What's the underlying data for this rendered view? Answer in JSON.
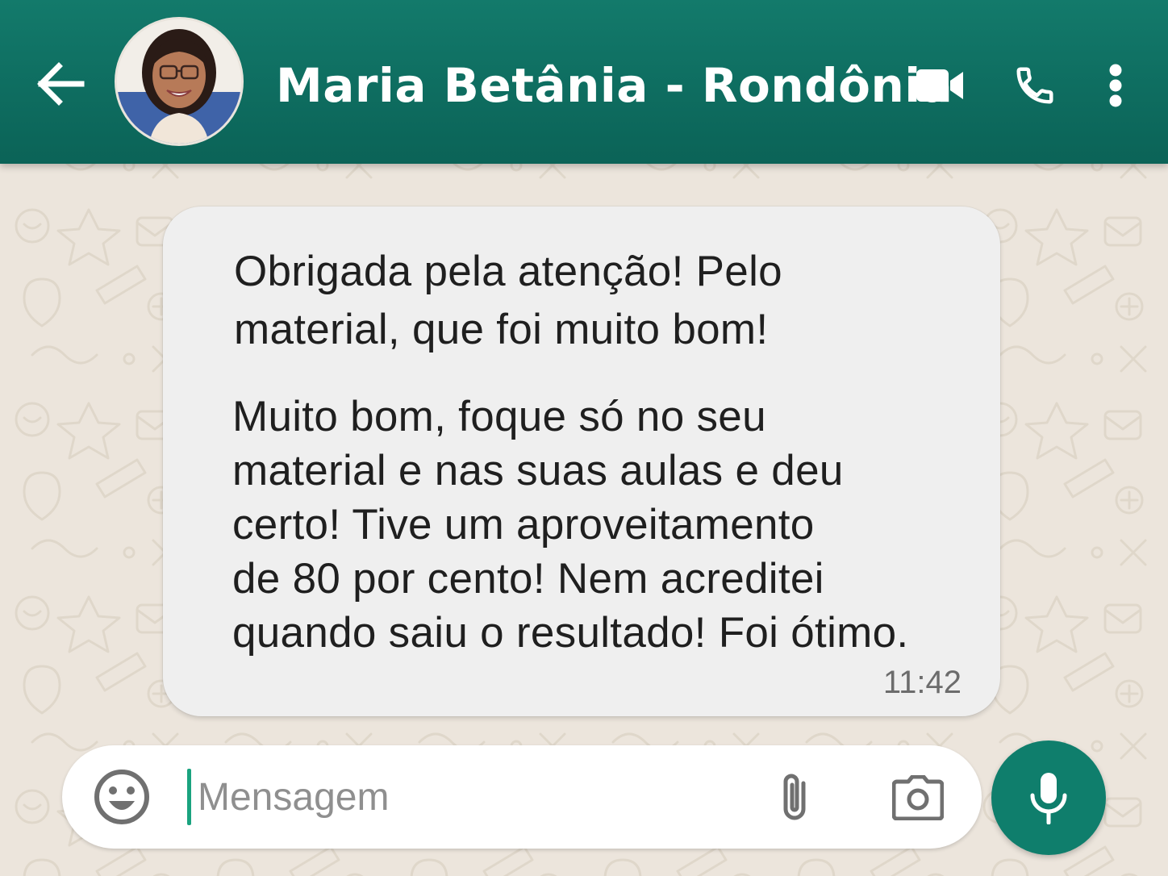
{
  "header": {
    "contact_name": "Maria Betânia - Rondônia",
    "back_icon": "arrow-left-icon",
    "video_icon": "video-camera-icon",
    "call_icon": "phone-icon",
    "menu_icon": "more-vertical-icon",
    "background_color": "#0e6d60"
  },
  "conversation": {
    "messages": [
      {
        "paragraph_1": "Obrigada pela atenção! Pelo\nmaterial, que foi muito bom!",
        "paragraph_2": "Muito bom, foque só no seu\n material e nas suas aulas e deu\n certo! Tive um aproveitamento\n de 80 por cento! Nem acreditei\n quando saiu o resultado! Foi ótimo.",
        "time": "11:42"
      }
    ]
  },
  "composer": {
    "placeholder": "Mensagem",
    "emoji_icon": "emoji-icon",
    "attach_icon": "paperclip-icon",
    "camera_icon": "camera-icon",
    "mic_icon": "microphone-icon",
    "accent_color": "#0f7e6c"
  }
}
